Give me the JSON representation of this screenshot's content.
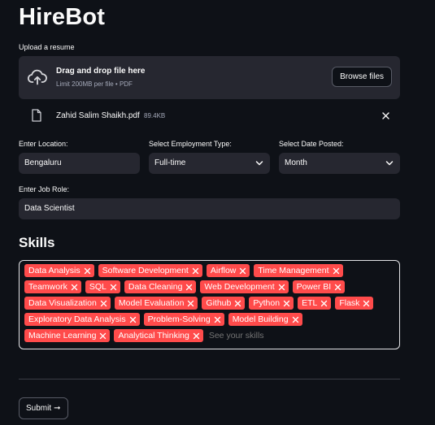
{
  "app": {
    "title": "HireBot"
  },
  "uploader": {
    "label": "Upload a resume",
    "drop_text": "Drag and drop file here",
    "limit_text": "Limit 200MB per file • PDF",
    "browse_label": "Browse files",
    "icon": "cloud-upload-icon"
  },
  "uploaded_file": {
    "name": "Zahid Salim Shaikh.pdf",
    "size": "89.4KB",
    "icon": "file-icon"
  },
  "location": {
    "label": "Enter Location:",
    "value": "Bengaluru"
  },
  "employment_type": {
    "label": "Select Employment Type:",
    "value": "Full-time"
  },
  "date_posted": {
    "label": "Select Date Posted:",
    "value": "Month"
  },
  "job_role": {
    "label": "Enter Job Role:",
    "value": "Data Scientist"
  },
  "skills": {
    "heading": "Skills",
    "placeholder": "See your skills",
    "tags": [
      "Data Analysis",
      "Software Development",
      "Airflow",
      "Time Management",
      "Teamwork",
      "SQL",
      "Data Cleaning",
      "Web Development",
      "Power BI",
      "Data Visualization",
      "Model Evaluation",
      "Github",
      "Python",
      "ETL",
      "Flask",
      "Exploratory Data Analysis",
      "Problem-Solving",
      "Model Building",
      "Machine Learning",
      "Analytical Thinking"
    ]
  },
  "submit": {
    "label": "Submit",
    "arrow": "➞"
  },
  "colors": {
    "background": "#0e1117",
    "field_background": "#262730",
    "tag_red": "#ff4b4b"
  }
}
